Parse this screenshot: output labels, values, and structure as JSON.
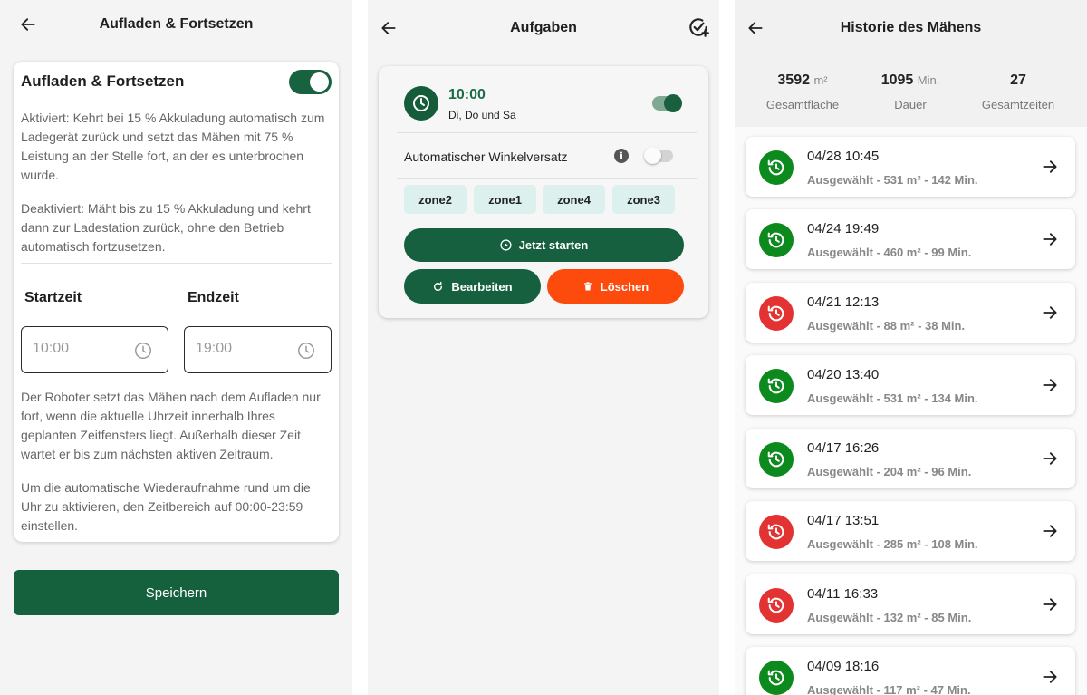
{
  "panel1": {
    "header_title": "Aufladen & Fortsetzen",
    "card_title": "Aufladen & Fortsetzen",
    "toggle_on": true,
    "activated_text": "Aktiviert: Kehrt bei 15 % Akkuladung automatisch zum Ladegerät zurück und setzt das Mähen mit 75 % Leistung an der Stelle fort, an der es unterbrochen wurde.",
    "deactivated_text": "Deaktiviert: Mäht bis zu 15 % Akkuladung und kehrt dann zur Ladestation zurück, ohne den Betrieb automatisch fortzusetzen.",
    "start_label": "Startzeit",
    "end_label": "Endzeit",
    "start_value": "10:00",
    "end_value": "19:00",
    "robot_text": "Der Roboter setzt das Mähen nach dem Aufladen nur fort, wenn die aktuelle Uhrzeit innerhalb Ihres geplanten Zeitfensters liegt. Außerhalb dieser Zeit wartet er bis zum nächsten aktiven Zeitraum.",
    "hint_text": "Um die automatische Wiederaufnahme rund um die Uhr zu aktivieren, den Zeitbereich auf 00:00-23:59 einstellen.",
    "save_label": "Speichern"
  },
  "panel2": {
    "header_title": "Aufgaben",
    "task_time": "10:00",
    "task_days": "Di, Do und Sa",
    "task_enabled": true,
    "winkel_label": "Automatischer Winkelversatz",
    "winkel_enabled": false,
    "zones": [
      "zone2",
      "zone1",
      "zone4",
      "zone3"
    ],
    "start_label": "Jetzt starten",
    "edit_label": "Bearbeiten",
    "delete_label": "Löschen"
  },
  "panel3": {
    "header_title": "Historie des Mähens",
    "stats": [
      {
        "value": "3592",
        "unit": "m²",
        "label": "Gesamtfläche"
      },
      {
        "value": "1095",
        "unit": "Min.",
        "label": "Dauer"
      },
      {
        "value": "27",
        "unit": "",
        "label": "Gesamtzeiten"
      }
    ],
    "history": [
      {
        "date": "04/28 10:45",
        "meta": "Ausgewählt - 531 m² - 142 Min.",
        "status": "ok"
      },
      {
        "date": "04/24 19:49",
        "meta": "Ausgewählt - 460 m² - 99 Min.",
        "status": "ok"
      },
      {
        "date": "04/21 12:13",
        "meta": "Ausgewählt - 88 m² - 38 Min.",
        "status": "fail"
      },
      {
        "date": "04/20 13:40",
        "meta": "Ausgewählt - 531 m² - 134 Min.",
        "status": "ok"
      },
      {
        "date": "04/17 16:26",
        "meta": "Ausgewählt - 204 m² - 96 Min.",
        "status": "ok"
      },
      {
        "date": "04/17 13:51",
        "meta": "Ausgewählt - 285 m² - 108 Min.",
        "status": "fail"
      },
      {
        "date": "04/11 16:33",
        "meta": "Ausgewählt - 132 m² - 85 Min.",
        "status": "fail"
      },
      {
        "date": "04/09 18:16",
        "meta": "Ausgewählt - 117 m² - 47 Min.",
        "status": "ok"
      }
    ]
  },
  "colors": {
    "primary_green": "#15603d",
    "delete_orange": "#fd4a0d",
    "status_ok": "#0c8a1e",
    "status_fail": "#e33232",
    "zone_bg": "#dcf1ee"
  },
  "icons": {
    "back": "arrow-left-icon",
    "clock": "clock-icon",
    "task_add": "calendar-check-add-icon",
    "info": "info-icon",
    "play": "play-circle-icon",
    "edit": "refresh-edit-icon",
    "delete": "trash-icon",
    "history": "history-icon",
    "arrow": "arrow-right-icon"
  }
}
